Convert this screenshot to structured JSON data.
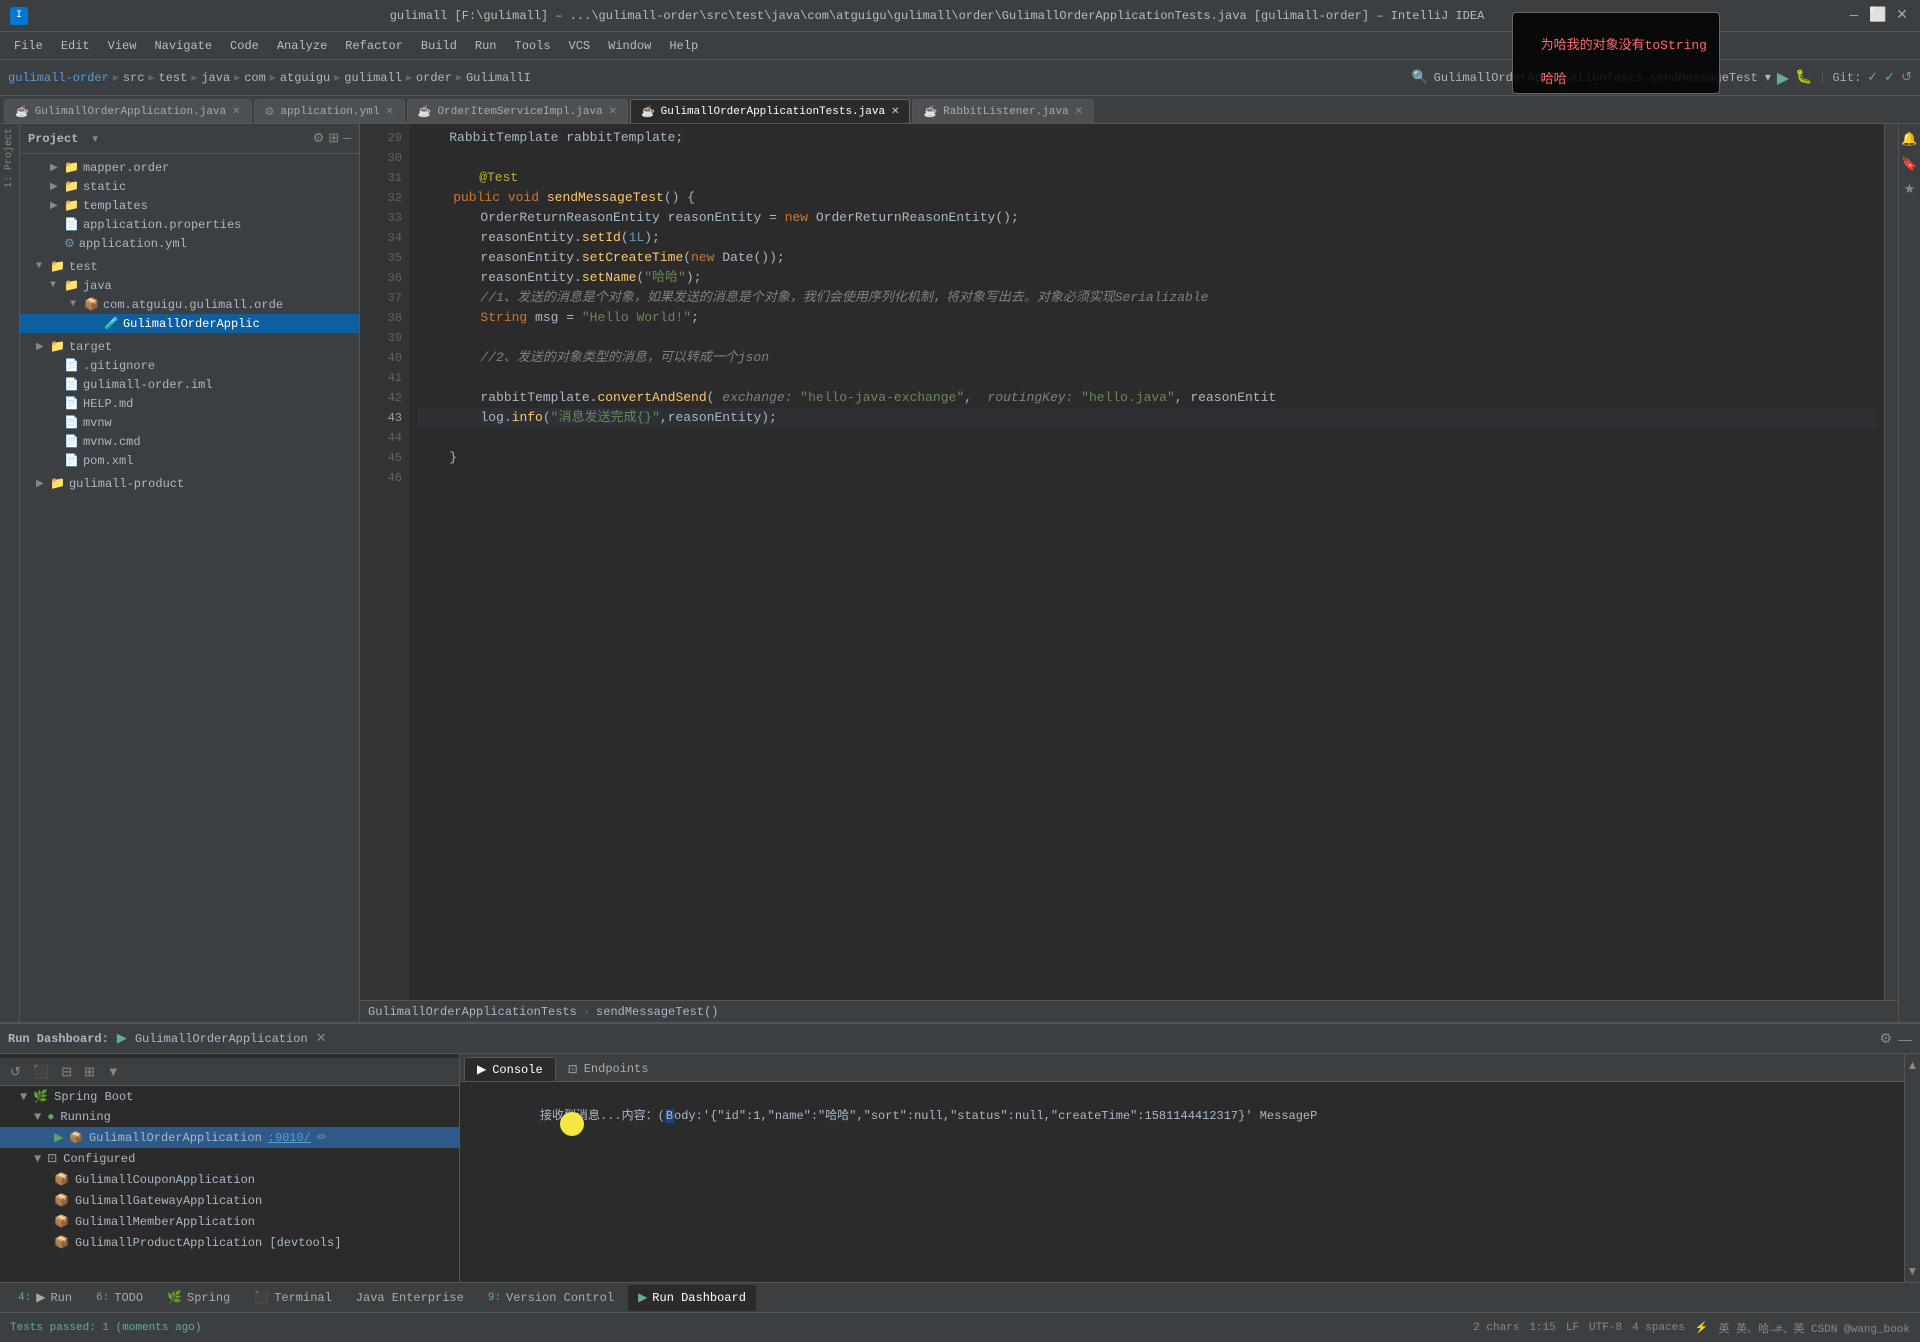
{
  "annotation": {
    "line1": "为哈我的对象没有toString",
    "line2": "哈哈"
  },
  "titlebar": {
    "title": "gulimall [F:\\gulimall] – ...\\gulimall-order\\src\\test\\java\\com\\atguigu\\gulimall\\order\\GulimallOrderApplicationTests.java [gulimall-order] – IntelliJ IDEA",
    "minimize": "—",
    "maximize": "⬜",
    "close": "✕"
  },
  "menu": {
    "items": [
      "File",
      "Edit",
      "View",
      "Navigate",
      "Code",
      "Analyze",
      "Refactor",
      "Build",
      "Run",
      "Tools",
      "VCS",
      "Window",
      "Help"
    ]
  },
  "breadcrumb": {
    "parts": [
      "gulimall-order",
      "src",
      "test",
      "java",
      "com",
      "atguigu",
      "gulimall",
      "order",
      "GulimallI",
      "GulimallOrderApplicationTests.sendMessageTest"
    ]
  },
  "file_tabs": [
    {
      "name": "GulimallOrderApplication.java",
      "active": false,
      "modified": false
    },
    {
      "name": "application.yml",
      "active": false,
      "modified": false
    },
    {
      "name": "OrderItemServiceImpl.java",
      "active": false,
      "modified": false
    },
    {
      "name": "GulimallOrderApplicationTests.java",
      "active": true,
      "modified": false
    },
    {
      "name": "RabbitListener.java",
      "active": false,
      "modified": false
    }
  ],
  "sidebar": {
    "title": "Project",
    "items": [
      {
        "level": 0,
        "label": "mapper.order",
        "type": "folder",
        "expanded": false
      },
      {
        "level": 0,
        "label": "static",
        "type": "folder",
        "expanded": false
      },
      {
        "level": 0,
        "label": "templates",
        "type": "folder",
        "expanded": false
      },
      {
        "level": 0,
        "label": "application.properties",
        "type": "props",
        "expanded": false
      },
      {
        "level": 0,
        "label": "application.yml",
        "type": "yaml",
        "expanded": false
      },
      {
        "level": -1,
        "label": "test",
        "type": "folder",
        "expanded": true
      },
      {
        "level": 0,
        "label": "java",
        "type": "folder",
        "expanded": true
      },
      {
        "level": 1,
        "label": "com.atguigu.gulimall.orde",
        "type": "folder",
        "expanded": true
      },
      {
        "level": 2,
        "label": "GulimallOrderAppli",
        "type": "java",
        "expanded": false,
        "selected": true
      },
      {
        "level": -1,
        "label": "target",
        "type": "folder",
        "expanded": false
      },
      {
        "level": 0,
        "label": ".gitignore",
        "type": "file",
        "expanded": false
      },
      {
        "level": 0,
        "label": "gulimall-order.iml",
        "type": "xml",
        "expanded": false
      },
      {
        "level": 0,
        "label": "HELP.md",
        "type": "md",
        "expanded": false
      },
      {
        "level": 0,
        "label": "mvnw",
        "type": "file",
        "expanded": false
      },
      {
        "level": 0,
        "label": "mvnw.cmd",
        "type": "file",
        "expanded": false
      },
      {
        "level": 0,
        "label": "pom.xml",
        "type": "xml",
        "expanded": false
      },
      {
        "level": -1,
        "label": "gulimall-product",
        "type": "folder",
        "expanded": false
      }
    ]
  },
  "code": {
    "lines": [
      {
        "num": 29,
        "content": "    RabbitTemplate rabbitTemplate;"
      },
      {
        "num": 30,
        "content": ""
      },
      {
        "num": 31,
        "content": "    @Test"
      },
      {
        "num": 32,
        "content": "    public void sendMessageTest() {"
      },
      {
        "num": 33,
        "content": "        OrderReturnReasonEntity reasonEntity = new OrderReturnReasonEntity();"
      },
      {
        "num": 34,
        "content": "        reasonEntity.setId(1L);"
      },
      {
        "num": 35,
        "content": "        reasonEntity.setCreateTime(new Date());"
      },
      {
        "num": 36,
        "content": "        reasonEntity.setName(\"哈哈\");"
      },
      {
        "num": 37,
        "content": "        //1、发送的消息是个对象，如果发送的消息是个对象，我们会使用序列化机制，将对象写出去。对象必须实现Serializable"
      },
      {
        "num": 38,
        "content": "        String msg = \"Hello World!\";"
      },
      {
        "num": 39,
        "content": ""
      },
      {
        "num": 40,
        "content": "        //2、发送的对象类型的消息，可以转成一个json"
      },
      {
        "num": 41,
        "content": ""
      },
      {
        "num": 42,
        "content": "        rabbitTemplate.convertAndSend( exchange: \"hello-java-exchange\",  routingKey: \"hello.java\", reasonEntit"
      },
      {
        "num": 43,
        "content": "        log.info(\"消息发送完成{}\",reasonEntity);"
      },
      {
        "num": 44,
        "content": ""
      },
      {
        "num": 45,
        "content": "    }"
      },
      {
        "num": 46,
        "content": ""
      }
    ],
    "breadcrumb": "GulimallOrderApplicationTests › sendMessageTest()"
  },
  "run_dashboard": {
    "title": "Run Dashboard:",
    "app_name": "GulimallOrderApplication",
    "tree_items": [
      {
        "label": "Spring Boot",
        "level": 0,
        "type": "springboot",
        "expanded": true
      },
      {
        "label": "Running",
        "level": 1,
        "type": "running",
        "expanded": true
      },
      {
        "label": "GulimallOrderApplication",
        "level": 2,
        "port": ":9010/",
        "type": "app",
        "selected": true
      },
      {
        "label": "Configured",
        "level": 1,
        "type": "configured",
        "expanded": true
      },
      {
        "label": "GulimallCouponApplication",
        "level": 2,
        "type": "app"
      },
      {
        "label": "GulimallGatewayApplication",
        "level": 2,
        "type": "app"
      },
      {
        "label": "GulimallMemberApplication",
        "level": 2,
        "type": "app"
      },
      {
        "label": "GulimallProductApplication [devtools]",
        "level": 2,
        "type": "app"
      }
    ]
  },
  "console": {
    "tabs": [
      {
        "label": "Console",
        "active": true,
        "icon": "▶"
      },
      {
        "label": "Endpoints",
        "active": false,
        "icon": "⊡"
      }
    ],
    "output": "接收到消息...内容：(Body:'{\"id\":1,\"name\":\"哈哈\",\"sort\":null,\"status\":null,\"createTime\":1581144412317}' MessageP"
  },
  "status_bar": {
    "tests_passed": "Tests passed: 1 (moments ago)",
    "chars": "2 chars",
    "position": "1:15",
    "line_ending": "LF",
    "encoding": "UTF-8",
    "indent": "4 spaces",
    "git_user": "英 英、哈→#、英 @wang_book"
  },
  "bottom_tabs": [
    {
      "num": "4",
      "label": "Run",
      "active": false
    },
    {
      "num": "6",
      "label": "TODO",
      "active": false
    },
    {
      "label": "Spring",
      "active": false,
      "num": ""
    },
    {
      "label": "Terminal",
      "active": false,
      "num": ""
    },
    {
      "label": "Java Enterprise",
      "active": false,
      "num": ""
    },
    {
      "num": "9",
      "label": "Version Control",
      "active": false
    },
    {
      "label": "Run Dashboard",
      "active": true,
      "num": ""
    }
  ]
}
